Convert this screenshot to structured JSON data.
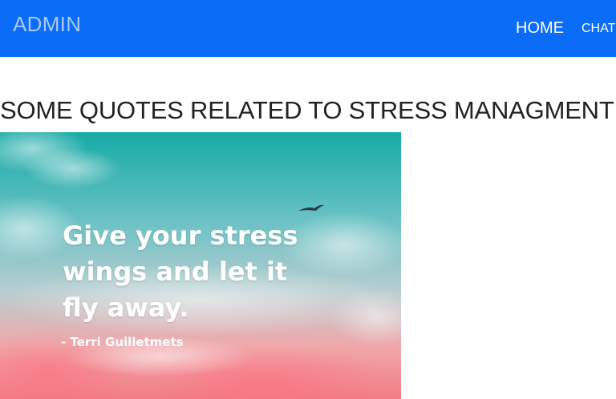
{
  "navbar": {
    "brand": "ADMIN",
    "links": [
      {
        "label": "HOME"
      },
      {
        "label": "CHAT"
      }
    ],
    "background": "#0b6cf7"
  },
  "main": {
    "heading": "SOME QUOTES RELATED TO STRESS MANAGMENT",
    "quote_image": {
      "lines": [
        "Give your stress",
        "wings and let it",
        "fly away."
      ],
      "author": "- Terri Guilletmets",
      "sky_top_color": "#1fb3ad",
      "sky_bottom_color": "#f4838f",
      "bird_icon": "bird-icon"
    }
  }
}
